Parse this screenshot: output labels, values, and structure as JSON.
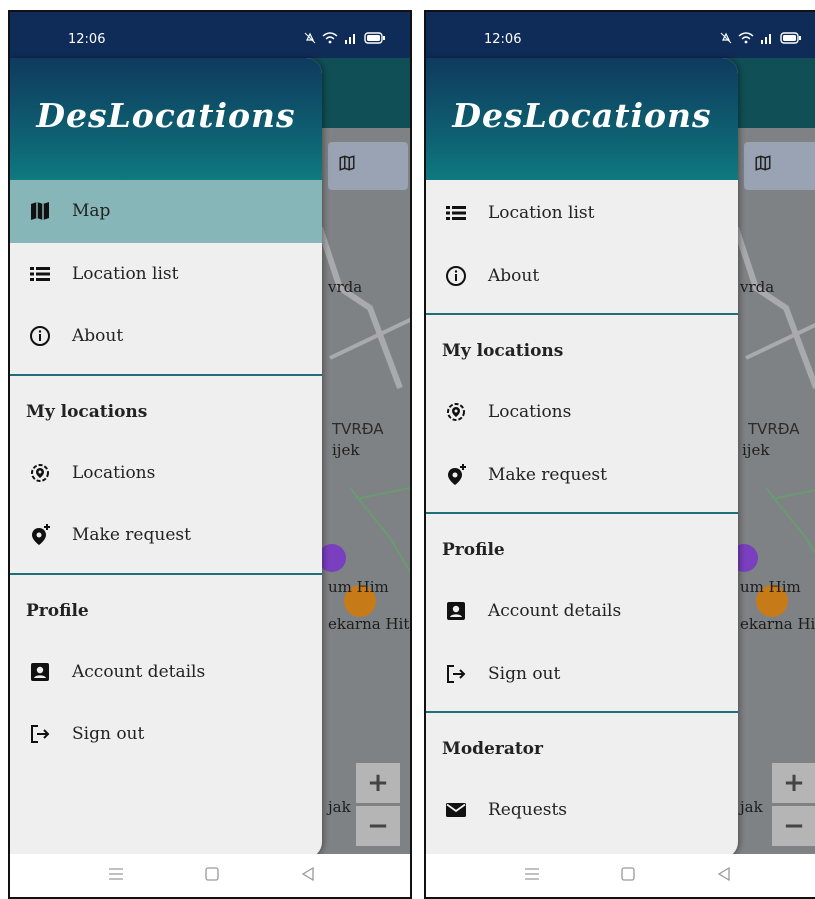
{
  "status": {
    "time": "12:06"
  },
  "app": {
    "logo": "DesLocations"
  },
  "map": {
    "labels": [
      "vrda",
      "TVRĐA",
      "ijek",
      "um Him",
      "ekarna Hit",
      "jak"
    ],
    "zoom_in": "+",
    "zoom_out": "−"
  },
  "left": {
    "items": [
      {
        "label": "Map",
        "icon": "map-icon",
        "active": true
      },
      {
        "label": "Location list",
        "icon": "list-icon"
      },
      {
        "label": "About",
        "icon": "info-icon"
      }
    ],
    "sections": [
      {
        "title": "My locations",
        "items": [
          {
            "label": "Locations",
            "icon": "location-target-icon"
          },
          {
            "label": "Make request",
            "icon": "add-location-icon"
          }
        ]
      },
      {
        "title": "Profile",
        "items": [
          {
            "label": "Account details",
            "icon": "account-box-icon"
          },
          {
            "label": "Sign out",
            "icon": "logout-icon"
          }
        ]
      }
    ]
  },
  "right": {
    "items": [
      {
        "label": "Location list",
        "icon": "list-icon"
      },
      {
        "label": "About",
        "icon": "info-icon"
      }
    ],
    "sections": [
      {
        "title": "My locations",
        "items": [
          {
            "label": "Locations",
            "icon": "location-target-icon"
          },
          {
            "label": "Make request",
            "icon": "add-location-icon"
          }
        ]
      },
      {
        "title": "Profile",
        "items": [
          {
            "label": "Account details",
            "icon": "account-box-icon"
          },
          {
            "label": "Sign out",
            "icon": "logout-icon"
          }
        ]
      },
      {
        "title": "Moderator",
        "items": [
          {
            "label": "Requests",
            "icon": "mail-icon"
          }
        ]
      }
    ]
  },
  "colors": {
    "header_start": "#0f3a5e",
    "header_end": "#0f7a80",
    "active_item": "#86b6b8",
    "divider": "#1f6f78"
  }
}
